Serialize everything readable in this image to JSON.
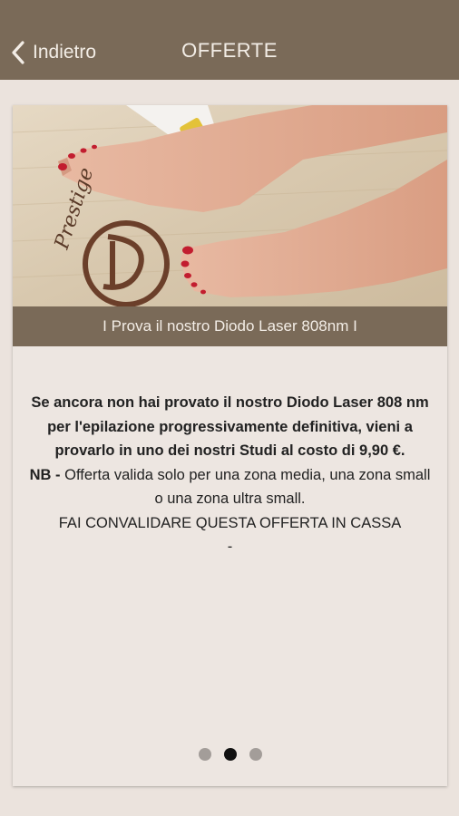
{
  "navbar": {
    "back_label": "Indietro",
    "title": "OFFERTE"
  },
  "offer": {
    "image_alt": "Feet on towel with diode laser device",
    "logo_text": "Prestige",
    "caption": "I Prova il nostro Diodo Laser 808nm I",
    "body_bold": "Se ancora non hai provato il nostro Diodo Laser 808 nm per l'epilazione progressivamente definitiva, vieni a provarlo in uno dei nostri Studi al costo di 9,90 €.",
    "nb_label": "NB -",
    "nb_text": " Offerta valida solo per una zona media, una zona small o una zona ultra small.",
    "cta_text": "FAI CONVALIDARE QUESTA OFFERTA IN CASSA",
    "dash": "-"
  },
  "pager": {
    "total": 3,
    "active_index": 1
  },
  "colors": {
    "brand": "#7a6a58",
    "background": "#ebe3dd",
    "card": "#ede6e1",
    "text": "#222222",
    "dot_active": "#111111",
    "dot_inactive": "#a39d99"
  }
}
